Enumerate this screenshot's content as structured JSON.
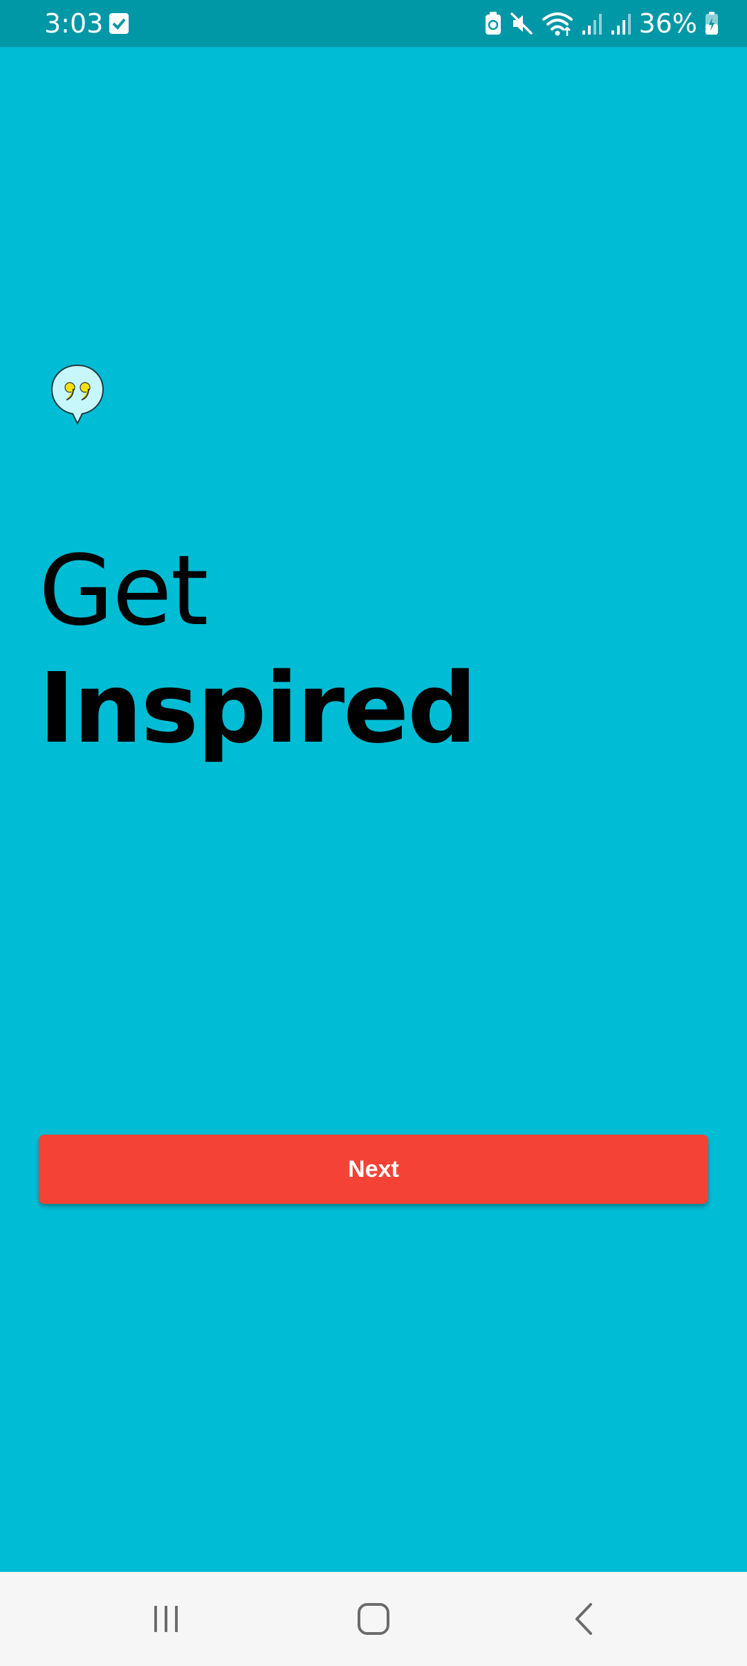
{
  "status_bar": {
    "time": "3:03",
    "battery_percent": "36%",
    "icons": [
      "check-notification-icon",
      "battery-saver-icon",
      "mute-icon",
      "wifi-icon",
      "signal-icon",
      "signal-icon",
      "battery-icon"
    ]
  },
  "onboarding": {
    "logo_icon": "quote-bubble-icon",
    "headline_line1": "Get",
    "headline_line2": "Inspired",
    "next_label": "Next"
  },
  "nav_bar": {
    "icons": [
      "recents-icon",
      "home-icon",
      "back-icon"
    ]
  },
  "colors": {
    "background": "#00BCD4",
    "status_bar": "#0097A7",
    "button": "#F44336",
    "button_text": "#FFFFFF",
    "headline": "#000000",
    "nav_bar": "#F6F6F6"
  }
}
